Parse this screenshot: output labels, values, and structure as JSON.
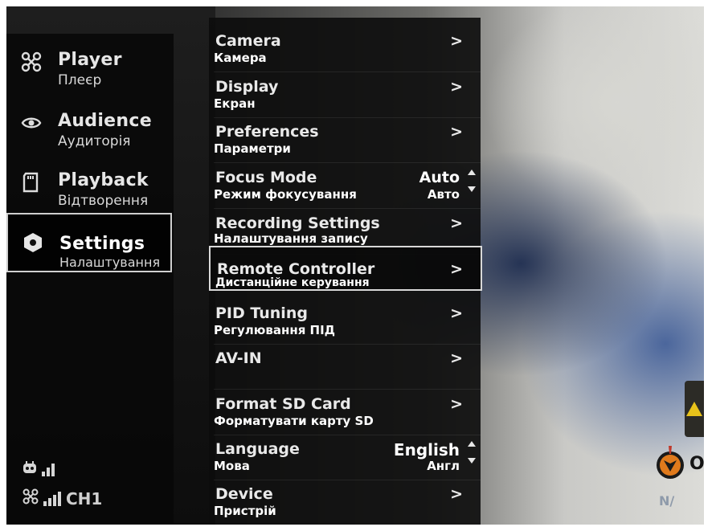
{
  "sidebar": {
    "items": [
      {
        "label": "Player",
        "sub": "Плеєр",
        "icon": "drone-icon"
      },
      {
        "label": "Audience",
        "sub": "Аудиторія",
        "icon": "eye-icon"
      },
      {
        "label": "Playback",
        "sub": "Відтворення",
        "icon": "sd-card-icon"
      },
      {
        "label": "Settings",
        "sub": "Налаштування",
        "icon": "hexagon-settings-icon",
        "selected": true
      }
    ],
    "status": {
      "remote_signal_icon": "controller-icon",
      "drone_signal_icon": "drone-icon",
      "channel": "CH1"
    }
  },
  "menu": {
    "arrow": ">",
    "items": [
      {
        "label": "Camera",
        "sub": "Камера"
      },
      {
        "label": "Display",
        "sub": "Екран"
      },
      {
        "label": "Preferences",
        "sub": "Параметри"
      },
      {
        "label": "Focus Mode",
        "sub": "Режим фокусування",
        "value": "Auto",
        "value_sub": "Авто"
      },
      {
        "label": "Recording Settings",
        "sub": "Налаштування запису"
      },
      {
        "label": "Remote Controller",
        "sub": "Дистанційне керування",
        "highlighted": true
      },
      {
        "label": "PID Tuning",
        "sub": "Регулювання ПІД"
      },
      {
        "label": "AV-IN",
        "sub": ""
      },
      {
        "label": "Format SD Card",
        "sub": "Форматувати карту SD"
      },
      {
        "label": "Language",
        "sub": "Мова",
        "value": "English",
        "value_sub": "Англ"
      },
      {
        "label": "Device",
        "sub": "Пристрій"
      }
    ]
  },
  "overlay": {
    "logo_text": "Os",
    "corner_text": "N/",
    "colors": {
      "logo_orange": "#e07a1c",
      "logo_dark": "#1a1a1a",
      "warning_yellow": "#e8c21a"
    }
  }
}
